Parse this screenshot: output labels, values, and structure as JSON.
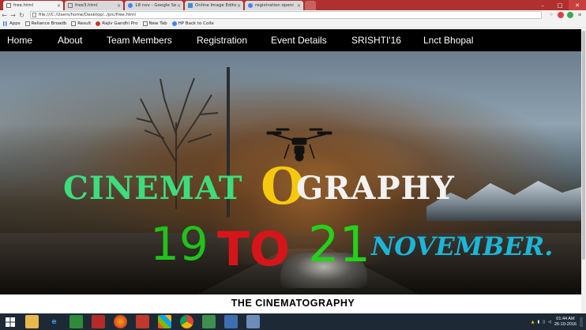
{
  "browser": {
    "tabs": [
      {
        "label": "free.html",
        "active": true
      },
      {
        "label": "free3.html",
        "active": false
      },
      {
        "label": "18 nov - Google Se",
        "active": false
      },
      {
        "label": "Online Image Edito",
        "active": false
      },
      {
        "label": "registration openi",
        "active": false
      }
    ],
    "address": "file:///C:/Users/home/Desktop/../pic/free.html",
    "bookmarks": [
      {
        "label": "Apps",
        "icon": "apps-grid-icon"
      },
      {
        "label": "Reliance Broadb",
        "icon": "page-icon"
      },
      {
        "label": "Result",
        "icon": "page-icon"
      },
      {
        "label": "Rajiv Gandhi Pro",
        "icon": "emblem-icon"
      },
      {
        "label": "New Tab",
        "icon": "page-icon"
      },
      {
        "label": "HP Back to Colle",
        "icon": "google-icon"
      }
    ]
  },
  "nav": {
    "items": [
      "Home",
      "About",
      "Team Members",
      "Registration",
      "Event Details",
      "SRISHTI'16",
      "Lnct Bhopal"
    ]
  },
  "hero": {
    "headline_part1": "CINEMAT",
    "headline_o": "O",
    "headline_part2": "GRAPHY",
    "date_from": "19",
    "date_to": "TO",
    "date_until": "21",
    "date_month": "NOVEMBER."
  },
  "section": {
    "title": "THE CINEMATOGRAPHY"
  },
  "taskbar": {
    "time": "01:44 AM",
    "date": "26-10-2016"
  },
  "colors": {
    "tab_strip": "#b0302f",
    "nav_bg": "#000000",
    "headline_green": "#3ddc7c",
    "headline_o": "#f6c90e",
    "headline_white": "#f2f2f2",
    "date_green": "#22d21b",
    "date_red": "#d6151b",
    "month_cyan": "#1bb6d8",
    "taskbar_bg": "#1d2a36"
  }
}
